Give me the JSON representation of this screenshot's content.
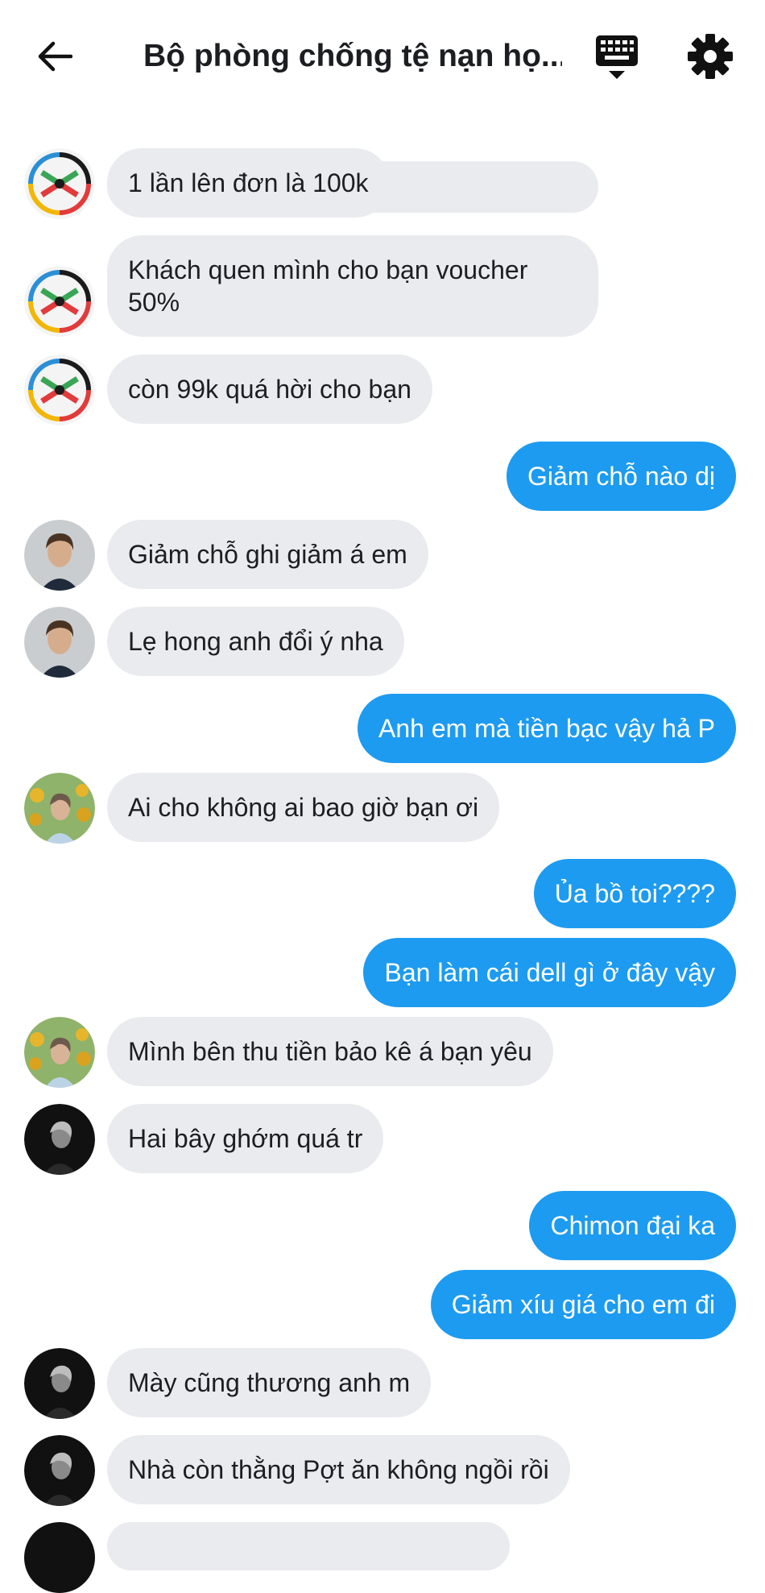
{
  "header": {
    "title": "Bộ phòng chống tệ nạn họ...",
    "back_icon": "arrow-left-icon",
    "keyboard_icon": "keyboard-icon",
    "settings_icon": "gear-icon"
  },
  "colors": {
    "incoming_bubble": "#e9ebef",
    "outgoing_bubble": "#1d9bf0",
    "outgoing_text": "#ffffff"
  },
  "messages": [
    {
      "side": "in",
      "sender": "group-logo",
      "text": ""
    },
    {
      "side": "in",
      "sender": "group-logo",
      "text": "1 lần lên đơn là 100k"
    },
    {
      "side": "in",
      "sender": "group-logo",
      "text": "Khách quen mình cho bạn voucher 50%"
    },
    {
      "side": "in",
      "sender": "group-logo",
      "text": "còn 99k quá hời cho bạn"
    },
    {
      "side": "out",
      "text": "Giảm chỗ nào dị"
    },
    {
      "side": "in",
      "sender": "man-suit",
      "text": "Giảm chỗ ghi giảm á em"
    },
    {
      "side": "in",
      "sender": "man-suit",
      "text": "Lẹ hong anh đổi ý nha"
    },
    {
      "side": "out",
      "text": "Anh em mà tiền bạc vậy hả P"
    },
    {
      "side": "in",
      "sender": "sunflower-boy",
      "text": "Ai cho không ai bao giờ bạn ơi"
    },
    {
      "side": "out",
      "text": "Ủa bồ toi????"
    },
    {
      "side": "out",
      "text": "Bạn làm cái dell gì ở đây vậy"
    },
    {
      "side": "in",
      "sender": "sunflower-boy",
      "text": "Mình bên thu tiền bảo kê á bạn yêu"
    },
    {
      "side": "in",
      "sender": "dark-portrait",
      "text": "Hai bây ghớm quá tr"
    },
    {
      "side": "out",
      "text": "Chimon đại ka"
    },
    {
      "side": "out",
      "text": "Giảm xíu giá cho em đi"
    },
    {
      "side": "in",
      "sender": "dark-portrait",
      "text": "Mày cũng thương anh m"
    },
    {
      "side": "in",
      "sender": "dark-portrait",
      "text": "Nhà còn thằng Pợt ăn không ngồi rồi"
    }
  ]
}
